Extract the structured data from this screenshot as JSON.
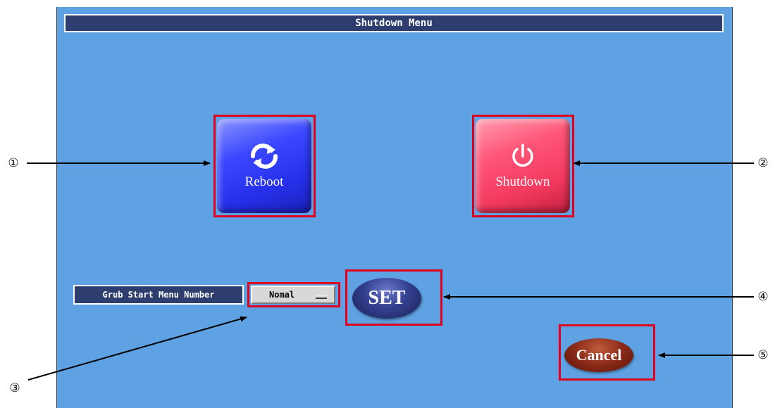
{
  "window": {
    "title": "Shutdown Menu"
  },
  "buttons": {
    "reboot": {
      "label": "Reboot",
      "icon": "refresh-icon",
      "color": "#3a47ff"
    },
    "shutdown": {
      "label": "Shutdown",
      "icon": "power-icon",
      "color": "#f23a5e"
    },
    "set": {
      "label": "SET",
      "color": "#33408f"
    },
    "cancel": {
      "label": "Cancel",
      "color": "#8a2a18"
    }
  },
  "grub": {
    "label": "Grub Start Menu Number",
    "selected": "Nomal"
  },
  "callouts": [
    "①",
    "②",
    "③",
    "④",
    "⑤"
  ],
  "colors": {
    "background": "#5ea2e3",
    "titlebar": "#2c3d6e",
    "highlight": "#e0001b"
  }
}
